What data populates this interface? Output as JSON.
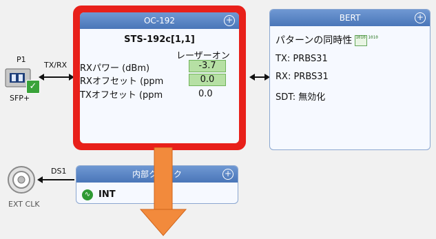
{
  "port": {
    "name": "P1",
    "type": "SFP+",
    "link_label": "TX/RX"
  },
  "oc_card": {
    "title": "OC-192",
    "path": "STS-192c[1,1]",
    "laser_status": "レーザーオン",
    "rows": [
      {
        "label": "RXパワー (dBm)",
        "value": "-3.7"
      },
      {
        "label": "RXオフセット (ppm",
        "value": "0.0"
      },
      {
        "label": "TXオフセット (ppm",
        "value": "0.0"
      }
    ]
  },
  "bert_card": {
    "title": "BERT",
    "pattern_sync_label": "パターンの同時性",
    "pattern_icon_text": "1010 1010",
    "tx": "TX: PRBS31",
    "rx": "RX: PRBS31",
    "sdt": "SDT: 無効化"
  },
  "clock": {
    "port_name": "DS1",
    "ext_label": "EXT CLK",
    "card_title": "内部クロック",
    "source": "INT"
  },
  "colors": {
    "highlight_border": "#e8201a",
    "arrow_orange": "#f28a3c",
    "header_blue": "#5a84c4",
    "value_green": "#b6e0a4"
  }
}
